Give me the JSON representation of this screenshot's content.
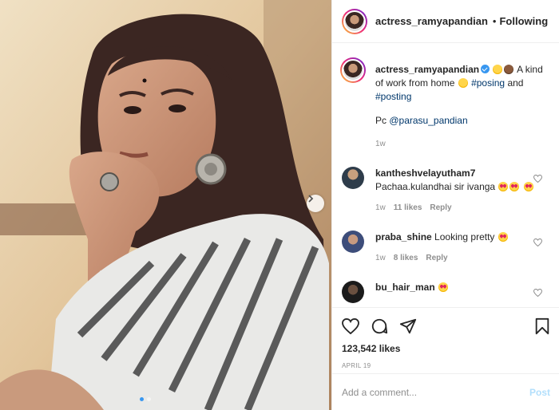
{
  "header": {
    "username": "actress_ramyapandian",
    "separator": "•",
    "follow_status": "Following"
  },
  "caption": {
    "username": "actress_ramyapandian",
    "text_1": "A kind of work from home",
    "hashtag_1": "#posing",
    "and": "and",
    "hashtag_2": "#posting",
    "credit_prefix": "Pc",
    "credit_mention": "@parasu_pandian",
    "time": "1w"
  },
  "comments": [
    {
      "username": "kantheshvelayutham7",
      "text": "Pachaa.kulandhai sir ivanga",
      "time": "1w",
      "likes": "11 likes",
      "reply": "Reply"
    },
    {
      "username": "praba_shine",
      "text": "Looking pretty",
      "time": "1w",
      "likes": "8 likes",
      "reply": "Reply"
    },
    {
      "username": "bu_hair_man",
      "text": ""
    }
  ],
  "post": {
    "likes": "123,542 likes",
    "date": "APRIL 19"
  },
  "add_comment": {
    "placeholder": "Add a comment...",
    "post_label": "Post"
  },
  "colors": {
    "accent": "#3897f0",
    "link": "#00376b",
    "muted": "#8e8e8e",
    "post_disabled": "#b2dffc"
  },
  "icons": [
    "next-arrow-icon",
    "heart-icon",
    "comment-icon",
    "share-icon",
    "bookmark-icon",
    "verified-icon"
  ]
}
